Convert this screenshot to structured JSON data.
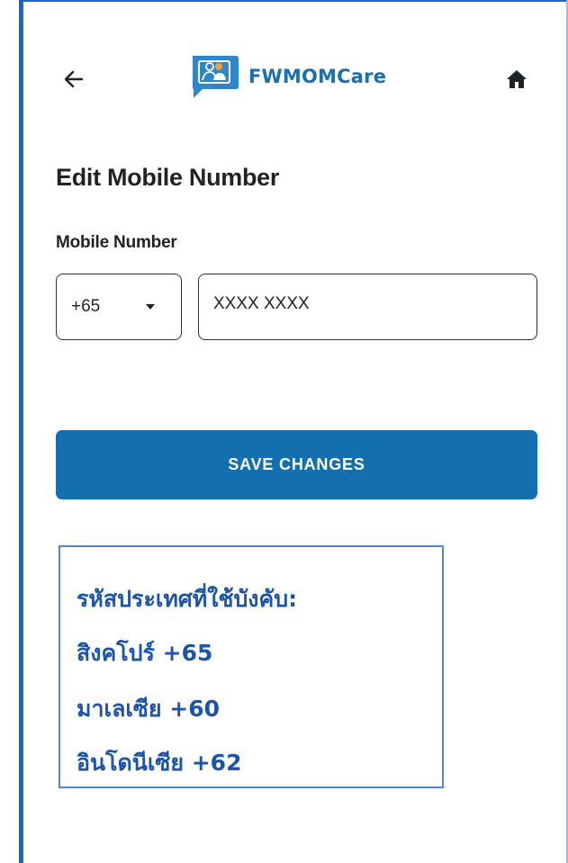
{
  "header": {
    "brand_name": "FWMOMCare",
    "back_icon": "arrow-left-icon",
    "home_icon": "home-icon",
    "logo_icon": "fwmomcare-logo-icon"
  },
  "page": {
    "title": "Edit Mobile Number"
  },
  "form": {
    "mobile_label": "Mobile Number",
    "country_code": "+65",
    "number_placeholder": "XXXX XXXX",
    "save_label": "SAVE CHANGES"
  },
  "info": {
    "heading": "รหัสประเทศที่ใช้บังคับ:",
    "items": [
      "สิงคโปร์ +65",
      "มาเลเซีย +60",
      "อินโดนีเซีย +62"
    ]
  },
  "colors": {
    "brand": "#1a6fb0",
    "button": "#146fae",
    "info_text": "#1b54a8",
    "info_border": "#4f86cf",
    "frame_rule": "#1e63c8"
  }
}
